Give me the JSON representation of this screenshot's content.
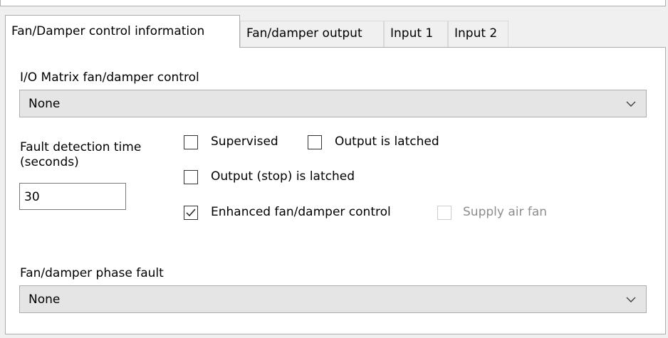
{
  "tabs": [
    {
      "label": "Fan/Damper control information",
      "active": true
    },
    {
      "label": "Fan/damper output",
      "active": false
    },
    {
      "label": "Input 1",
      "active": false
    },
    {
      "label": "Input 2",
      "active": false
    }
  ],
  "io_matrix": {
    "label": "I/O Matrix fan/damper control",
    "selected": "None"
  },
  "fault_detection": {
    "label_line1": "Fault detection time",
    "label_line2": "(seconds)",
    "value": "30"
  },
  "checkboxes": {
    "supervised": {
      "label": "Supervised",
      "checked": false,
      "enabled": true
    },
    "output_latched": {
      "label": "Output is latched",
      "checked": false,
      "enabled": true
    },
    "output_stop_latched": {
      "label": "Output (stop) is latched",
      "checked": false,
      "enabled": true
    },
    "enhanced_control": {
      "label": "Enhanced fan/damper control",
      "checked": true,
      "enabled": true
    },
    "supply_air_fan": {
      "label": "Supply air fan",
      "checked": false,
      "enabled": false
    }
  },
  "phase_fault": {
    "label": "Fan/damper phase fault",
    "selected": "None"
  },
  "icons": {
    "dropdown": "chevron-down-icon",
    "check": "checkmark-icon"
  },
  "colors": {
    "panel": "#ffffff",
    "background": "#f0f0f0",
    "border": "#adadad",
    "combo_fill": "#e5e5e5",
    "disabled_text": "#8d8d8d"
  }
}
